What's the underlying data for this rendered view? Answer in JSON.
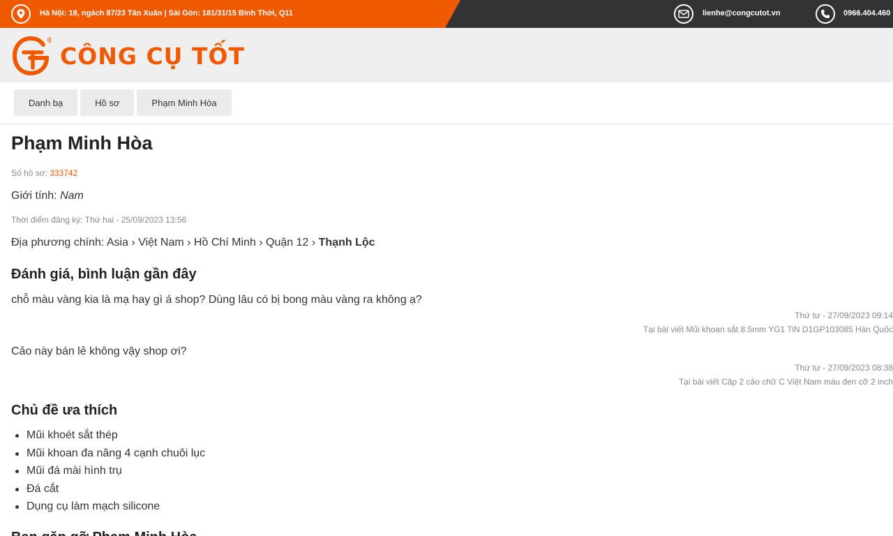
{
  "topbar": {
    "address": "Hà Nội: 18, ngách 87/23 Tân Xuân | Sài Gòn: 181/31/15 Bình Thới, Q11",
    "email": "lienhe@congcutot.vn",
    "phone": "0966.404.460"
  },
  "logo": {
    "text": "CÔNG CỤ TỐT",
    "registered": "®"
  },
  "breadcrumb": [
    "Danh bạ",
    "Hồ sơ",
    "Phạm Minh Hòa"
  ],
  "profile": {
    "name": "Phạm Minh Hòa",
    "id_label": "Số hồ sơ: ",
    "id_value": "333742",
    "gender_label": "Giới tính: ",
    "gender_value": "Nam",
    "registered": "Thời điểm đăng ký: Thứ hai - 25/09/2023 13:56",
    "location_label": "Địa phương chính: Asia › Việt Nam › Hồ Chí Minh › Quận 12 › ",
    "location_last": "Thạnh Lộc"
  },
  "reviews": {
    "title": "Đánh giá, bình luận gần đây",
    "items": [
      {
        "text": "chỗ màu vàng kia là mạ hay gì á shop? Dùng lâu có bị bong màu vàng ra không ạ?",
        "time": "Thứ tư - 27/09/2023 09:14",
        "post": "Tại bài viết Mũi khoan sắt 8.5mm YG1 TiN D1GP103085 Hàn Quốc"
      },
      {
        "text": "Cảo này bán lẻ không vậy shop ơi?",
        "time": "Thứ tư - 27/09/2023 08:38",
        "post": "Tại bài viết Cặp 2 cảo chữ C Việt Nam màu đen cỡ 2 inch"
      }
    ]
  },
  "favorites": {
    "title": "Chủ đề ưa thích",
    "items": [
      "Mũi khoét sắt thép",
      "Mũi khoan đa năng 4 cạnh chuôi lục",
      "Mũi đá mài hình trụ",
      "Đá cắt",
      "Dụng cụ làm mạch silicone"
    ]
  },
  "next_section": {
    "title": "Bạn gặp gỡ Phạm Minh Hòa"
  },
  "colors": {
    "accent": "#ef5a00",
    "topbar_dark": "#333333",
    "header_bg": "#efefef"
  },
  "icons": [
    "location-pin-icon",
    "email-icon",
    "phone-icon"
  ]
}
